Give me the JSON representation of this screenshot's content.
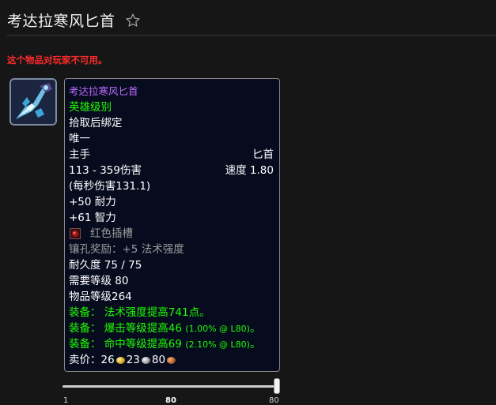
{
  "header": {
    "title": "考达拉寒风匕首",
    "favorite_icon": "star-outline-icon"
  },
  "warning": "这个物品对玩家不可用。",
  "item": {
    "icon": "ice-dagger-icon",
    "name": "考达拉寒风匕首",
    "quality": "英雄级别",
    "bind": "拾取后绑定",
    "unique": "唯一",
    "slot": "主手",
    "type": "匕首",
    "damage": "113 - 359伤害",
    "speed": "速度 1.80",
    "dps": "(每秒伤害131.1)",
    "stamina": "+50 耐力",
    "intellect": "+61 智力",
    "socket": {
      "icon": "red-socket-icon",
      "label": "红色插槽"
    },
    "socket_bonus": "镶孔奖励：+5 法术强度",
    "durability": "耐久度 75 / 75",
    "required_level": "需要等级 80",
    "item_level": "物品等级264",
    "equip": [
      {
        "label": "装备：",
        "text": "法术强度提高741点。",
        "note": ""
      },
      {
        "label": "装备：",
        "text": "爆击等级提高46",
        "note": "(1.00% @ L80)"
      },
      {
        "label": "装备：",
        "text": "命中等级提高69",
        "note": "(2.10% @ L80)"
      }
    ],
    "sell": {
      "label": "卖价：",
      "gold": "26",
      "silver": "23",
      "copper": "80"
    }
  },
  "level_slider": {
    "min": "1",
    "current": "80",
    "max": "80",
    "value_fraction": 1.0
  },
  "colors": {
    "background": "#161616",
    "epic": "#b96cff",
    "uncommon_green": "#1eff00",
    "warning_red": "#ff2a2a",
    "tooltip_bg": "#070b1e"
  }
}
